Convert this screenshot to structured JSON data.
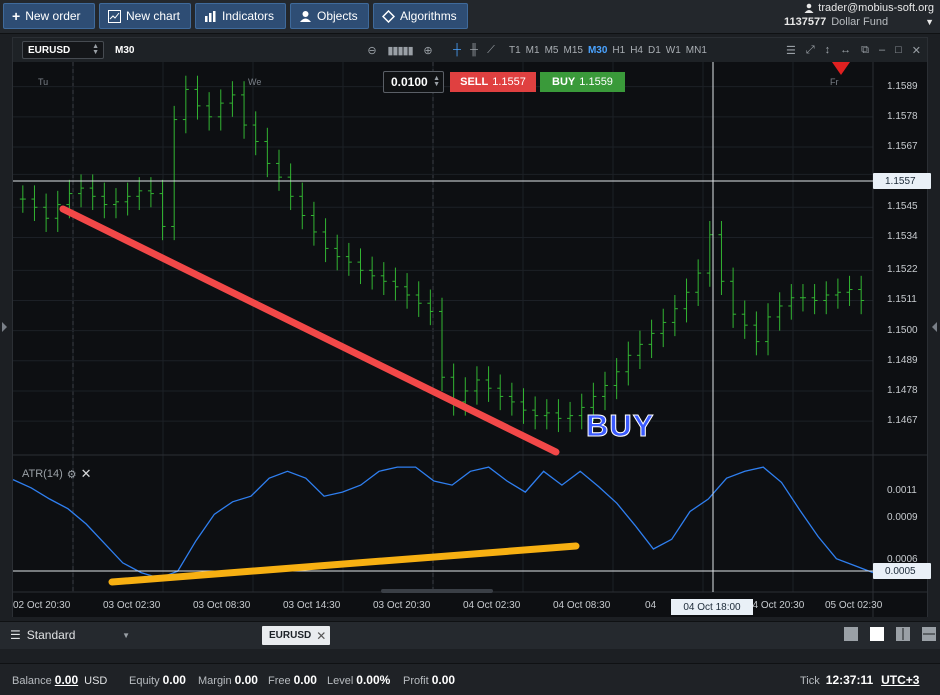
{
  "toolbar": {
    "new_order": "New order",
    "new_chart": "New chart",
    "indicators": "Indicators",
    "objects": "Objects",
    "algorithms": "Algorithms"
  },
  "account": {
    "user": "trader@mobius-soft.org",
    "number": "1137577",
    "name": "Dollar Fund"
  },
  "chart": {
    "symbol": "EURUSD",
    "timeframe": "M30",
    "timeframes": [
      "T1",
      "M1",
      "M5",
      "M15",
      "M30",
      "H1",
      "H4",
      "D1",
      "W1",
      "MN1"
    ],
    "active_timeframe": "M30",
    "lot": "0.0100",
    "sell_label": "SELL",
    "sell_price": "1.1557",
    "buy_label": "BUY",
    "buy_price": "1.1559",
    "current_price_tag": "1.1557",
    "atr_current_tag": "0.0005",
    "crosshair_time": "04 Oct 18:00",
    "annotation": "BUY",
    "day_labels": [
      "Tu",
      "We",
      "Fr"
    ],
    "indicator_label": "ATR(14)"
  },
  "chart_data": [
    {
      "type": "bar",
      "series_kind": "ohlc",
      "y_ticks": [
        "1.1589",
        "1.1578",
        "1.1567",
        "1.1557",
        "1.1545",
        "1.1534",
        "1.1522",
        "1.1511",
        "1.1500",
        "1.1489",
        "1.1478",
        "1.1467"
      ],
      "x_ticks": [
        "02 Oct 20:30",
        "03 Oct 02:30",
        "03 Oct 08:30",
        "03 Oct 14:30",
        "03 Oct 20:30",
        "04 Oct 02:30",
        "04 Oct 08:30",
        "04 Oct 18:00",
        "04 Oct 20:30",
        "05 Oct 02:30"
      ],
      "ylim": [
        1.1455,
        1.1598
      ],
      "close_values": [
        1.1548,
        1.1545,
        1.1541,
        1.1546,
        1.155,
        1.1552,
        1.1549,
        1.1546,
        1.1547,
        1.1549,
        1.1551,
        1.155,
        1.1538,
        1.1577,
        1.1588,
        1.1582,
        1.1578,
        1.1583,
        1.1586,
        1.1575,
        1.1569,
        1.1561,
        1.1556,
        1.1549,
        1.1542,
        1.1536,
        1.153,
        1.1527,
        1.1525,
        1.1522,
        1.152,
        1.1518,
        1.1516,
        1.1513,
        1.151,
        1.1507,
        1.1483,
        1.1474,
        1.1478,
        1.1482,
        1.1479,
        1.1476,
        1.1474,
        1.1471,
        1.1469,
        1.147,
        1.1468,
        1.1469,
        1.1472,
        1.1476,
        1.148,
        1.1485,
        1.1491,
        1.1495,
        1.1499,
        1.1503,
        1.1508,
        1.1514,
        1.1521,
        1.1535,
        1.1518,
        1.1506,
        1.1502,
        1.1496,
        1.1505,
        1.1509,
        1.1512,
        1.1512,
        1.1511,
        1.1513,
        1.1514,
        1.1515,
        1.1511
      ]
    },
    {
      "type": "line",
      "title": "ATR(14)",
      "y_ticks": [
        "0.0011",
        "0.0009",
        "0.0006",
        "0.0005"
      ],
      "ylim": [
        0.00037,
        0.00135
      ],
      "values": [
        0.00118,
        0.00112,
        0.00104,
        0.00097,
        0.00086,
        0.00072,
        0.00058,
        0.00051,
        0.00047,
        0.00052,
        0.00074,
        0.00093,
        0.00102,
        0.00106,
        0.00119,
        0.00124,
        0.00119,
        0.00106,
        0.00109,
        0.00114,
        0.00124,
        0.00127,
        0.00127,
        0.00117,
        0.00114,
        0.00124,
        0.00127,
        0.00117,
        0.00109,
        0.00124,
        0.00114,
        0.00124,
        0.00113,
        0.00101,
        0.00085,
        0.00068,
        0.00075,
        0.00095,
        0.00104,
        0.00119,
        0.00124,
        0.00127,
        0.00116,
        0.00096,
        0.00077,
        0.00061,
        0.00056,
        0.00051
      ]
    }
  ],
  "tabs": {
    "workspace": "Standard",
    "chart_tab": "EURUSD"
  },
  "status": {
    "balance_label": "Balance",
    "balance_value": "0.00",
    "balance_currency": "USD",
    "equity_label": "Equity",
    "equity_value": "0.00",
    "margin_label": "Margin",
    "margin_value": "0.00",
    "free_label": "Free",
    "free_value": "0.00",
    "level_label": "Level",
    "level_value": "0.00%",
    "profit_label": "Profit",
    "profit_value": "0.00",
    "tick_label": "Tick",
    "time": "12:37:11",
    "timezone": "UTC+3"
  },
  "colors": {
    "up_bar": "#32b432",
    "atr_line": "#2f7ff0",
    "red_trend": "#f24848",
    "orange_trend": "#f7b012",
    "buy_text": "#3b5bff"
  }
}
